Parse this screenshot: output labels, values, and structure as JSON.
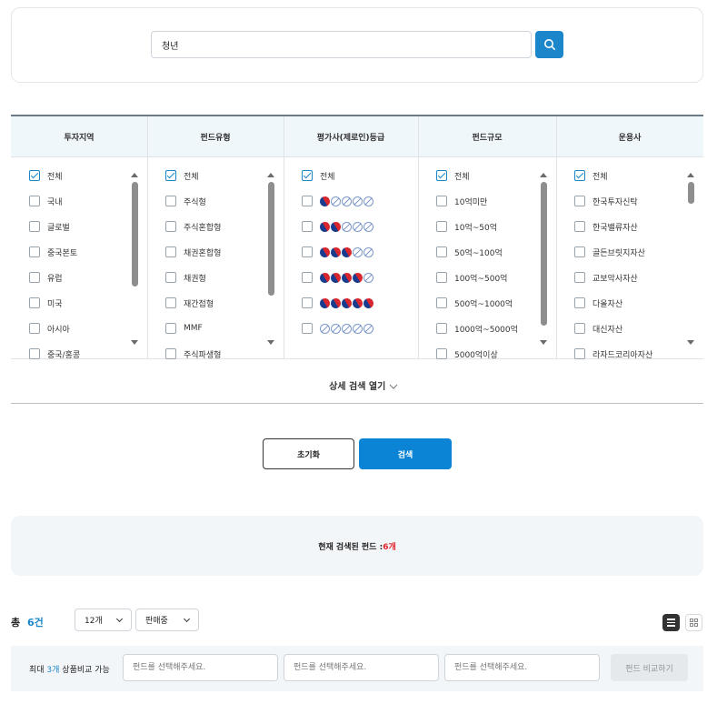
{
  "search": {
    "value": "청년"
  },
  "filters": {
    "columns": [
      {
        "title": "투자지역",
        "options": [
          {
            "label": "전체",
            "checked": true
          },
          {
            "label": "국내",
            "checked": false
          },
          {
            "label": "글로벌",
            "checked": false
          },
          {
            "label": "중국본토",
            "checked": false
          },
          {
            "label": "유럽",
            "checked": false
          },
          {
            "label": "미국",
            "checked": false
          },
          {
            "label": "아시아",
            "checked": false
          },
          {
            "label": "중국/홍콩",
            "checked": false
          }
        ]
      },
      {
        "title": "펀드유형",
        "options": [
          {
            "label": "전체",
            "checked": true
          },
          {
            "label": "주식형",
            "checked": false
          },
          {
            "label": "주식혼합형",
            "checked": false
          },
          {
            "label": "채권혼합형",
            "checked": false
          },
          {
            "label": "채권형",
            "checked": false
          },
          {
            "label": "재간접형",
            "checked": false
          },
          {
            "label": "MMF",
            "checked": false
          },
          {
            "label": "주식파생형",
            "checked": false
          }
        ]
      },
      {
        "title": "평가사(제로인)등급",
        "options": [
          {
            "label": "전체",
            "checked": true
          },
          {
            "rating": 1,
            "checked": false
          },
          {
            "rating": 2,
            "checked": false
          },
          {
            "rating": 3,
            "checked": false
          },
          {
            "rating": 4,
            "checked": false
          },
          {
            "rating": 5,
            "checked": false
          },
          {
            "rating": 0,
            "checked": false
          }
        ]
      },
      {
        "title": "펀드규모",
        "options": [
          {
            "label": "전체",
            "checked": true
          },
          {
            "label": "10억미만",
            "checked": false
          },
          {
            "label": "10억~50억",
            "checked": false
          },
          {
            "label": "50억~100억",
            "checked": false
          },
          {
            "label": "100억~500억",
            "checked": false
          },
          {
            "label": "500억~1000억",
            "checked": false
          },
          {
            "label": "1000억~5000억",
            "checked": false
          },
          {
            "label": "5000억이상",
            "checked": false
          }
        ]
      },
      {
        "title": "운용사",
        "options": [
          {
            "label": "전체",
            "checked": true
          },
          {
            "label": "한국투자신탁",
            "checked": false
          },
          {
            "label": "한국밸류자산",
            "checked": false
          },
          {
            "label": "골든브릿지자산",
            "checked": false
          },
          {
            "label": "교보악사자산",
            "checked": false
          },
          {
            "label": "다올자산",
            "checked": false
          },
          {
            "label": "대신자산",
            "checked": false
          },
          {
            "label": "라자드코리아자산",
            "checked": false
          }
        ]
      }
    ]
  },
  "detail_toggle": "상세 검색 열기",
  "buttons": {
    "reset": "초기화",
    "search": "검색"
  },
  "result": {
    "prefix": "현재 검색된 펀드 : ",
    "count": "6개"
  },
  "list_controls": {
    "total_prefix": "총",
    "total_count": "6건",
    "page_size": "12개",
    "status_filter": "판매중"
  },
  "compare": {
    "label_prefix": "최대 ",
    "label_count": "3개",
    "label_suffix": " 상품비교 가능",
    "placeholder": "펀드를 선택해주세요.",
    "button": "펀드 비교하기"
  },
  "colors": {
    "accent": "#1b86c9",
    "highlight": "#e0262d"
  }
}
